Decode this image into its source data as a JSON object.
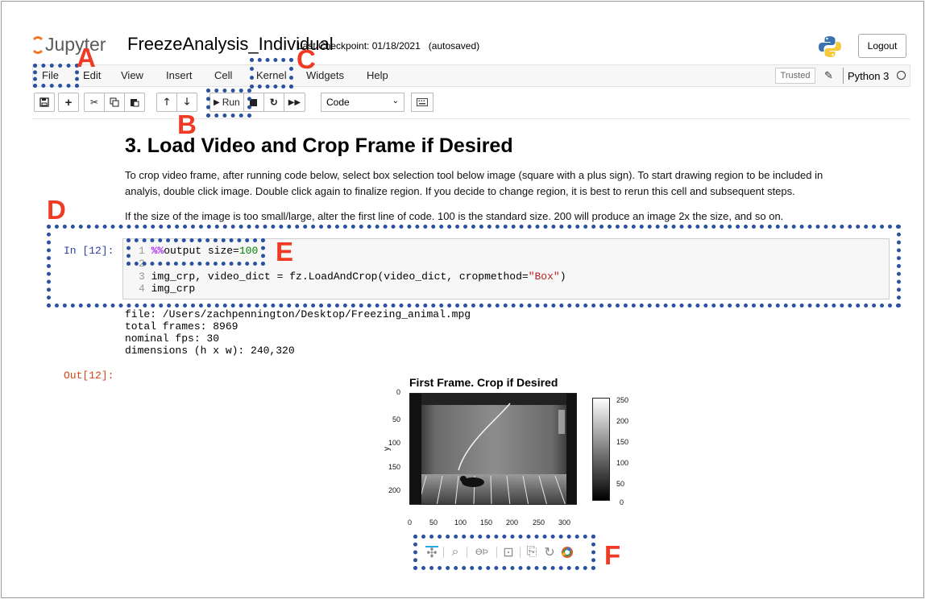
{
  "header": {
    "logo_text": "Jupyter",
    "notebook_name": "FreezeAnalysis_Individual",
    "checkpoint": "Last Checkpoint: 01/18/2021",
    "autosaved": "(autosaved)",
    "logout_label": "Logout"
  },
  "menu": {
    "items": [
      "File",
      "Edit",
      "View",
      "Insert",
      "Cell",
      "Kernel",
      "Widgets",
      "Help"
    ],
    "trusted": "Trusted",
    "kernel_name": "Python 3"
  },
  "toolbar": {
    "run_label": "Run",
    "cell_type": "Code",
    "icons": [
      "save-icon",
      "plus-icon",
      "cut-icon",
      "copy-icon",
      "paste-icon",
      "arrow-up-icon",
      "arrow-down-icon",
      "run-icon",
      "stop-icon",
      "restart-icon",
      "fast-forward-icon",
      "keyboard-icon"
    ]
  },
  "markdown": {
    "heading": "3. Load Video and Crop Frame if Desired",
    "para1_line1": "To crop video frame, after running code below, select box selection tool below image (square with a plus sign). To start drawing region to be included in",
    "para1_line2": "analyis, double click image. Double click again to finalize region. If you decide to change region, it is best to rerun this cell and subsequent steps.",
    "para2": "If the size of the image is too small/large, alter the first line of code. 100 is the standard size. 200 will produce an image 2x the size, and so on."
  },
  "code_cell": {
    "in_prompt": "In [12]:",
    "out_prompt": "Out[12]:",
    "line_numbers": [
      "1",
      "2",
      "3",
      "4"
    ],
    "line1_magic": "%%",
    "line1_text": "output size=",
    "line1_value": "100",
    "line3_prefix": "img_crp, video_dict = fz.LoadAndCrop(video_dict, cropmethod=",
    "line3_string": "\"Box\"",
    "line3_suffix": ")",
    "line4": "img_crp"
  },
  "output": {
    "lines": [
      "file: /Users/zachpennington/Desktop/Freezing_animal.mpg",
      "total frames: 8969",
      "nominal fps: 30",
      "dimensions (h x w): 240,320"
    ]
  },
  "chart_data": {
    "type": "heatmap",
    "title": "First Frame.  Crop if Desired",
    "ylabel": "y",
    "xlabel": "",
    "x_ticks": [
      "0",
      "50",
      "100",
      "150",
      "200",
      "250",
      "300"
    ],
    "y_ticks": [
      "0",
      "50",
      "100",
      "150",
      "200"
    ],
    "colorbar_ticks": [
      "250",
      "200",
      "150",
      "100",
      "50",
      "0"
    ],
    "xlim": [
      0,
      320
    ],
    "ylim": [
      240,
      0
    ],
    "clim": [
      0,
      255
    ],
    "colormap": "grayscale"
  },
  "bokeh_tools": [
    "pan-icon",
    "box-zoom-icon",
    "lasso-select-icon",
    "box-edit-icon",
    "save-icon",
    "reset-icon",
    "bokeh-logo-icon"
  ],
  "annotations": {
    "labels": [
      "A",
      "B",
      "C",
      "D",
      "E",
      "F"
    ],
    "label_color": "#ef3a24",
    "box_color": "#2a52a0"
  }
}
